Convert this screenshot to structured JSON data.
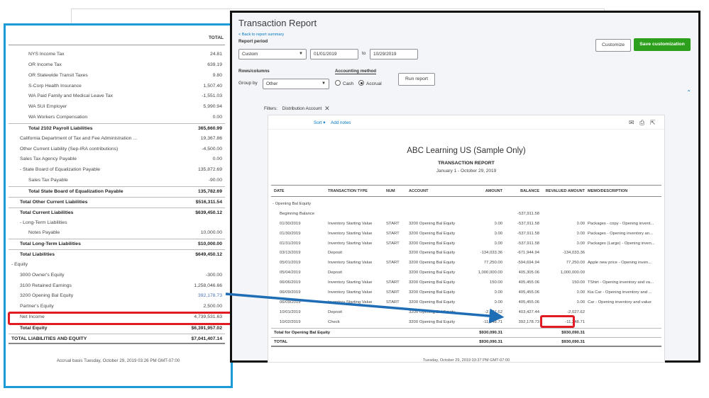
{
  "balance_sheet": {
    "total_header": "TOTAL",
    "rows": [
      {
        "label": "NYS Income Tax",
        "value": "24.81",
        "indent": 2,
        "style": ""
      },
      {
        "label": "OR Income Tax",
        "value": "639.19",
        "indent": 2,
        "style": ""
      },
      {
        "label": "OR Statewide Transit Taxes",
        "value": "9.80",
        "indent": 2,
        "style": ""
      },
      {
        "label": "S-Corp Health Insurance",
        "value": "1,507.40",
        "indent": 2,
        "style": ""
      },
      {
        "label": "WA Paid Family and Medical Leave Tax",
        "value": "-1,551.03",
        "indent": 2,
        "style": ""
      },
      {
        "label": "WA SUI Employer",
        "value": "5,990.94",
        "indent": 2,
        "style": ""
      },
      {
        "label": "WA Workers Compensation",
        "value": "0.00",
        "indent": 2,
        "style": ""
      },
      {
        "label": "Total 2102 Payroll Liabilities",
        "value": "365,660.99",
        "indent": 2,
        "style": "bold rule"
      },
      {
        "label": "California Department of Tax and Fee Administration ...",
        "value": "19,367.86",
        "indent": 1,
        "style": ""
      },
      {
        "label": "Other Current Liability (Sep-IRA contributions)",
        "value": "-4,500.00",
        "indent": 1,
        "style": ""
      },
      {
        "label": "Sales Tax Agency Payable",
        "value": "0.00",
        "indent": 1,
        "style": ""
      },
      {
        "label": "- State Board of Equalization Payable",
        "value": "135,872.69",
        "indent": 1,
        "style": ""
      },
      {
        "label": "Sales Tax Payable",
        "value": "-90.00",
        "indent": 2,
        "style": ""
      },
      {
        "label": "Total State Board of Equalization Payable",
        "value": "135,782.69",
        "indent": 2,
        "style": "bold rule"
      },
      {
        "label": "Total Other Current Liabilities",
        "value": "$516,311.54",
        "indent": 1,
        "style": "bold rule"
      },
      {
        "label": "Total Current Liabilities",
        "value": "$639,450.12",
        "indent": 1,
        "style": "bold rule"
      },
      {
        "label": "- Long-Term Liabilities",
        "value": "",
        "indent": 1,
        "style": ""
      },
      {
        "label": "Notes Payable",
        "value": "10,000.00",
        "indent": 2,
        "style": ""
      },
      {
        "label": "Total Long-Term Liabilities",
        "value": "$10,000.00",
        "indent": 1,
        "style": "bold rule"
      },
      {
        "label": "Total Liabilities",
        "value": "$649,450.12",
        "indent": 1,
        "style": "bold rule"
      },
      {
        "label": "- Equity",
        "value": "",
        "indent": 0,
        "style": ""
      },
      {
        "label": "3000 Owner's Equity",
        "value": "-300.00",
        "indent": 1,
        "style": ""
      },
      {
        "label": "3100 Retained Earnings",
        "value": "1,258,046.66",
        "indent": 1,
        "style": ""
      },
      {
        "label": "3200 Opening Bal Equity",
        "value": "392,178.73",
        "indent": 1,
        "style": "highlight"
      },
      {
        "label": "Partner's Equity",
        "value": "2,500.00",
        "indent": 1,
        "style": ""
      },
      {
        "label": "Net Income",
        "value": "4,739,531.63",
        "indent": 1,
        "style": ""
      },
      {
        "label": "Total Equity",
        "value": "$6,391,957.02",
        "indent": 1,
        "style": "bold rule"
      },
      {
        "label": "TOTAL LIABILITIES AND EQUITY",
        "value": "$7,041,407.14",
        "indent": 0,
        "style": "bold rule dbl"
      }
    ],
    "footer": "Accrual basis  Tuesday, October 29, 2019  03:26 PM GMT-07:00"
  },
  "transaction_report": {
    "title": "Transaction Report",
    "back_link": "< Back to report summary",
    "report_period_label": "Report period",
    "period_select": "Custom",
    "date_from": "01/01/2019",
    "to_label": "to",
    "date_to": "10/29/2019",
    "customize_label": "Customize",
    "save_customization_label": "Save customization",
    "rows_columns_label": "Rows/columns",
    "accounting_method_label": "Accounting method",
    "group_by_label": "Group by",
    "group_by_value": "Other",
    "cash_label": "Cash",
    "accrual_label": "Accrual",
    "run_report_label": "Run report",
    "filters_label": "Filters:",
    "filter_chip": "Distribution Account",
    "sort_label": "Sort",
    "add_notes_label": "Add notes",
    "company_name": "ABC Learning US (Sample Only)",
    "report_heading": "TRANSACTION REPORT",
    "date_range": "January 1 - October 29, 2019",
    "columns": [
      "DATE",
      "TRANSACTION TYPE",
      "NUM",
      "ACCOUNT",
      "AMOUNT",
      "BALANCE",
      "REVALUED AMOUNT",
      "MEMO/DESCRIPTION"
    ],
    "group_label": "- Opening Bal Equity",
    "rows": [
      {
        "date": "Beginning Balance",
        "type": "",
        "num": "",
        "account": "",
        "amount": "",
        "balance": "-537,911.58",
        "revalued": "",
        "memo": ""
      },
      {
        "date": "01/30/2019",
        "type": "Inventory Starting Value",
        "num": "START",
        "account": "3200 Opening Bal Equity",
        "amount": "0.00",
        "balance": "-537,911.58",
        "revalued": "0.00",
        "memo": "Packages - copy - Opening invent..."
      },
      {
        "date": "01/30/2019",
        "type": "Inventory Starting Value",
        "num": "START",
        "account": "3200 Opening Bal Equity",
        "amount": "0.00",
        "balance": "-537,911.58",
        "revalued": "0.00",
        "memo": "Packages - Opening inventory an..."
      },
      {
        "date": "01/31/2019",
        "type": "Inventory Starting Value",
        "num": "START",
        "account": "3200 Opening Bal Equity",
        "amount": "0.00",
        "balance": "-537,911.58",
        "revalued": "0.00",
        "memo": "Packages (Large) - Opening inven..."
      },
      {
        "date": "03/13/2019",
        "type": "Deposit",
        "num": "",
        "account": "3200 Opening Bal Equity",
        "amount": "-134,033.36",
        "balance": "-671,944.94",
        "revalued": "-134,033.36",
        "memo": ""
      },
      {
        "date": "05/01/2019",
        "type": "Inventory Starting Value",
        "num": "START",
        "account": "3200 Opening Bal Equity",
        "amount": "77,250.00",
        "balance": "-594,694.94",
        "revalued": "77,250.00",
        "memo": "Apple new price - Opening inven..."
      },
      {
        "date": "05/04/2019",
        "type": "Deposit",
        "num": "",
        "account": "3200 Opening Bal Equity",
        "amount": "1,000,000.00",
        "balance": "405,305.06",
        "revalued": "1,000,000.00",
        "memo": ""
      },
      {
        "date": "06/06/2019",
        "type": "Inventory Starting Value",
        "num": "START",
        "account": "3200 Opening Bal Equity",
        "amount": "150.00",
        "balance": "405,455.06",
        "revalued": "150.00",
        "memo": "TShirt - Opening inventory and va..."
      },
      {
        "date": "06/09/2019",
        "type": "Inventory Starting Value",
        "num": "START",
        "account": "3200 Opening Bal Equity",
        "amount": "0.00",
        "balance": "405,455.06",
        "revalued": "0.00",
        "memo": "Kia Car - Opening inventory and ..."
      },
      {
        "date": "06/09/2019",
        "type": "Inventory Starting Value",
        "num": "START",
        "account": "3200 Opening Bal Equity",
        "amount": "0.00",
        "balance": "405,455.06",
        "revalued": "0.00",
        "memo": "Car - Opening inventory and value"
      },
      {
        "date": "10/01/2019",
        "type": "Deposit",
        "num": "",
        "account": "3200 Opening Bal Equity",
        "amount": "-2,027.62",
        "balance": "403,427.44",
        "revalued": "-2,027.62",
        "memo": ""
      },
      {
        "date": "10/02/2019",
        "type": "Check",
        "num": "",
        "account": "3200 Opening Bal Equity",
        "amount": "-11,248.71",
        "balance": "392,178.73",
        "revalued": "-11,248.71",
        "memo": ""
      }
    ],
    "total_group_label": "Total for Opening Bal Equity",
    "total_group_amount": "$930,090.31",
    "total_group_revalued": "$930,090.31",
    "grand_total_label": "TOTAL",
    "grand_total_amount": "$930,090.31",
    "grand_total_revalued": "$930,090.31",
    "footer": "Tuesday, October 29, 2019  03:37 PM GMT-07:00"
  },
  "colors": {
    "left_border": "#1a9bd7",
    "highlight_red": "#e01b24",
    "arrow_blue": "#1f6db5",
    "green_button": "#2ca01c"
  }
}
